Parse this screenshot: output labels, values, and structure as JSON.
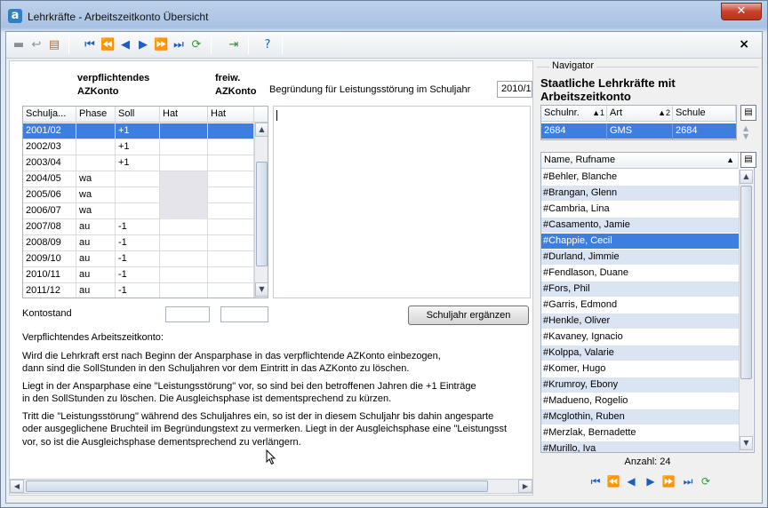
{
  "window": {
    "title": "Lehrkräfte - Arbeitszeitkonto Übersicht",
    "app_icon_letter": "a",
    "close_glyph": "✕"
  },
  "toolbar": {
    "buttons": [
      "save-icon",
      "undo-icon",
      "table-edit-icon",
      "first-record-icon",
      "prev-page-icon",
      "prev-record-icon",
      "next-record-icon",
      "next-page-icon",
      "last-record-icon",
      "refresh-icon",
      "export-icon",
      "help-icon"
    ],
    "close_glyph": "×"
  },
  "left": {
    "label_verpflichtend_1": "verpflichtendes",
    "label_verpflichtend_2": "AZKonto",
    "label_freiw_1": "freiw.",
    "label_freiw_2": "AZKonto",
    "begruendung_label": "Begründung für Leistungsstörung im Schuljahr",
    "begruendung_year": "2010/1",
    "columns": [
      "Schulja...",
      "Phase",
      "Soll",
      "Hat",
      "Hat"
    ],
    "rows": [
      {
        "jahr": "2001/02",
        "phase": "",
        "soll": "+1",
        "hat": "",
        "hat2": "",
        "grey": false
      },
      {
        "jahr": "2002/03",
        "phase": "",
        "soll": "+1",
        "hat": "",
        "hat2": "",
        "grey": false
      },
      {
        "jahr": "2003/04",
        "phase": "",
        "soll": "+1",
        "hat": "",
        "hat2": "",
        "grey": false
      },
      {
        "jahr": "2004/05",
        "phase": "wa",
        "soll": "",
        "hat": "",
        "hat2": "",
        "grey": true
      },
      {
        "jahr": "2005/06",
        "phase": "wa",
        "soll": "",
        "hat": "",
        "hat2": "",
        "grey": true
      },
      {
        "jahr": "2006/07",
        "phase": "wa",
        "soll": "",
        "hat": "",
        "hat2": "",
        "grey": true
      },
      {
        "jahr": "2007/08",
        "phase": "au",
        "soll": "-1",
        "hat": "",
        "hat2": "",
        "grey": false
      },
      {
        "jahr": "2008/09",
        "phase": "au",
        "soll": "-1",
        "hat": "",
        "hat2": "",
        "grey": false
      },
      {
        "jahr": "2009/10",
        "phase": "au",
        "soll": "-1",
        "hat": "",
        "hat2": "",
        "grey": false
      },
      {
        "jahr": "2010/11",
        "phase": "au",
        "soll": "-1",
        "hat": "",
        "hat2": "",
        "grey": false
      },
      {
        "jahr": "2011/12",
        "phase": "au",
        "soll": "-1",
        "hat": "",
        "hat2": "",
        "grey": false
      }
    ],
    "kontostand_label": "Kontostand",
    "kontostand_value_1": "",
    "kontostand_value_2": "",
    "ergaenzen_button": "Schuljahr ergänzen",
    "info_heading": "Verpflichtendes Arbeitszeitkonto:",
    "info_p1_l1": "Wird die Lehrkraft erst nach Beginn der Ansparphase in das verpflichtende AZKonto einbezogen,",
    "info_p1_l2": "dann sind die SollStunden in den Schuljahren vor dem Eintritt in das AZKonto zu löschen.",
    "info_p2_l1": "Liegt in der Ansparphase eine \"Leistungsstörung\" vor, so sind bei den betroffenen Jahren die +1 Einträge",
    "info_p2_l2": "in den SollStunden zu löschen. Die Ausgleichsphase ist dementsprechend zu kürzen.",
    "info_p3_l1": "Tritt die \"Leistungsstörung\" während des Schuljahres ein, so ist der in diesem Schuljahr bis dahin angesparte",
    "info_p3_l2": "oder ausgeglichene Bruchteil im Begründungstext zu vermerken. Liegt in der Ausgleichsphase eine \"Leistungsst",
    "info_p3_l3": "vor, so ist die Ausgleichsphase dementsprechend zu verlängern."
  },
  "navigator": {
    "group_title": "Navigator",
    "heading_1": "Staatliche Lehrkräfte mit",
    "heading_2": "Arbeitszeitkonto",
    "schul_columns": [
      "Schulnr.",
      "Art",
      "Schule"
    ],
    "schul_sort_marks": [
      "▲1",
      "▲2"
    ],
    "schul_row": {
      "nr": "2684",
      "art": "GMS",
      "schule": "2684"
    },
    "name_column": "Name, Rufname",
    "names": [
      "#Behler, Blanche",
      "#Brangan, Glenn",
      "#Cambria, Lina",
      "#Casamento, Jamie",
      "#Chappie, Cecil",
      "#Durland, Jimmie",
      "#Fendlason, Duane",
      "#Fors, Phil",
      "#Garris, Edmond",
      "#Henkle, Oliver",
      "#Kavaney, Ignacio",
      "#Kolppa, Valarie",
      "#Komer, Hugo",
      "#Krumroy, Ebony",
      "#Madueno, Rogelio",
      "#Mcglothin, Ruben",
      "#Merzlak, Bernadette",
      "#Murillo, Iva"
    ],
    "selected_index": 4,
    "anzahl": "Anzahl: 24",
    "nav_buttons": [
      "first-icon",
      "prev-page-icon",
      "prev-icon",
      "next-icon",
      "next-page-icon",
      "last-icon",
      "refresh-icon"
    ]
  },
  "colors": {
    "selection": "#3d7fe0",
    "alt_row": "#dbe4f3",
    "grey_cell": "#e4e4ea"
  }
}
